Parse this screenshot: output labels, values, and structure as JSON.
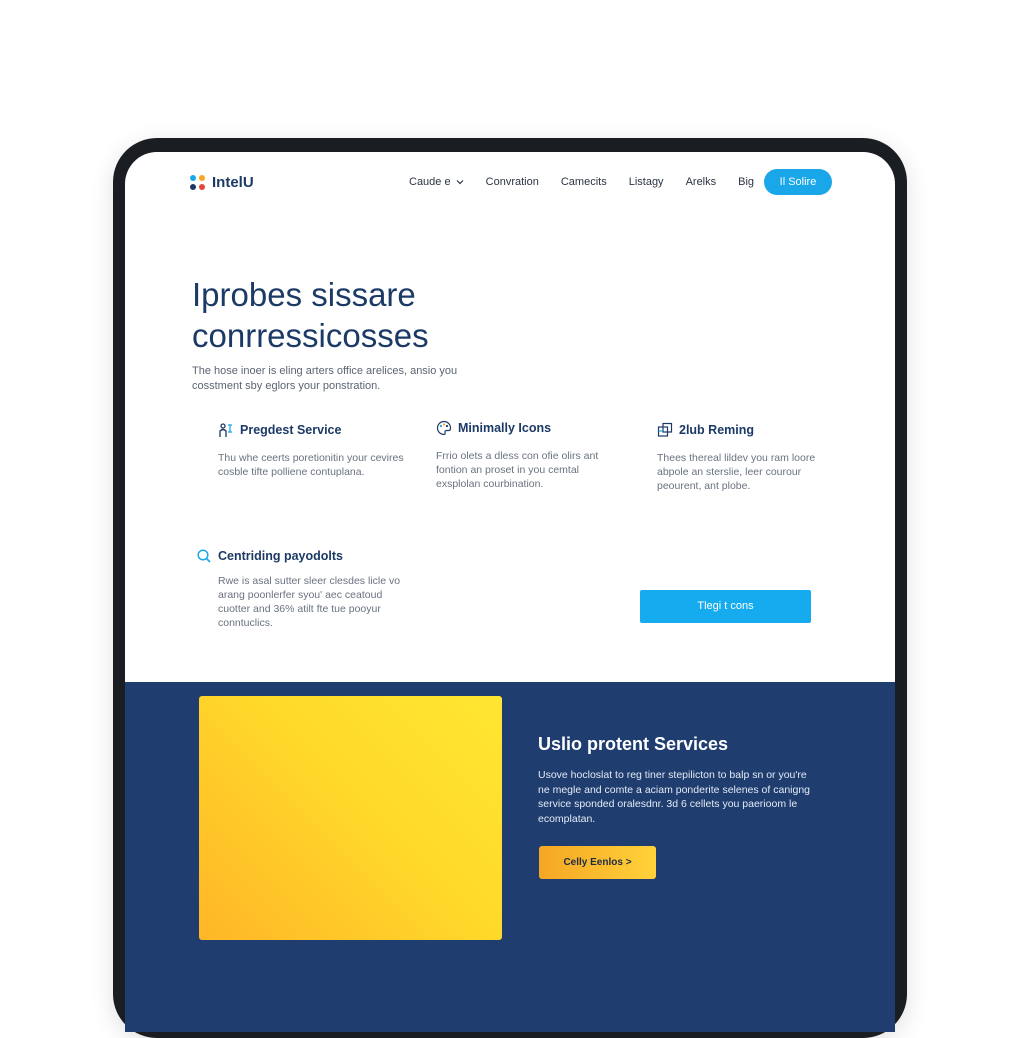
{
  "brand": {
    "name": "IntelU"
  },
  "nav": {
    "items": [
      {
        "label": "Caude e"
      },
      {
        "label": "Convration"
      },
      {
        "label": "Camecits"
      },
      {
        "label": "Listagy"
      },
      {
        "label": "Arelks"
      },
      {
        "label": "Big"
      }
    ],
    "cta_label": "Il Solire"
  },
  "hero": {
    "title_line1": "Iprobes sissare",
    "title_line2": "conrressicosses",
    "description": "The hose inoer is eling arters office arelices, ansio you cosstment sby eglors your ponstration."
  },
  "features": [
    {
      "title": "Pregdest Service",
      "icon": "people-icon",
      "description": "Thu whe ceerts poretionitin your cevires cosble tifte polliene contuplana."
    },
    {
      "title": "Minimally Icons",
      "icon": "palette-icon",
      "description": "Frrio olets a dless con ofie olirs ant fontion an proset in you cemtal exsplolan courbination."
    },
    {
      "title": "2lub Reming",
      "icon": "layout-icon",
      "description": "Thees thereal lildev you ram loore abpole an sterslie, leer courour peourent, ant plobe."
    },
    {
      "title": "Centriding payodolts",
      "icon": "search-icon",
      "description": "Rwe is asal sutter sleer clesdes licle vo arang poonlerfer syou' aec ceatoud cuotter and 36% atilt fte tue pooyur conntuclics."
    }
  ],
  "hero_cta": {
    "label": "Tlegi t cons"
  },
  "services": {
    "title": "Uslio protent Services",
    "description": "Usove hocloslat to reg tiner stepilicton to balp sn or you're ne megle and comte a aciam ponderite selenes of canigng service sponded oralesdnr. 3d 6 cellets you paerioom le ecomplatan.",
    "cta_label": "Celly Eenlos >"
  },
  "colors": {
    "navy": "#1c3a66",
    "accent_blue": "#16abee",
    "dark_section": "#1f3d6e",
    "yellow": "#ffd92a",
    "orange": "#f5a623"
  }
}
